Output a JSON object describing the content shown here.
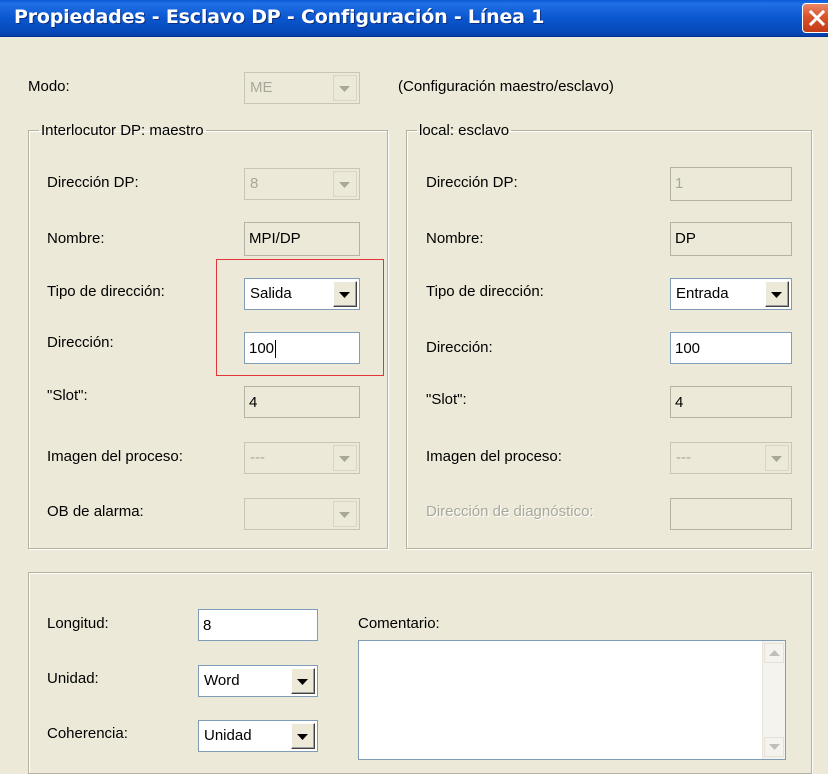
{
  "window": {
    "title": "Propiedades - Esclavo DP - Configuración - Línea 1"
  },
  "mode": {
    "label": "Modo:",
    "value": "ME",
    "description": "(Configuración maestro/esclavo)"
  },
  "master": {
    "legend": "Interlocutor DP: maestro",
    "dp_address_label": "Dirección DP:",
    "dp_address_value": "8",
    "name_label": "Nombre:",
    "name_value": "MPI/DP",
    "address_type_label": "Tipo de dirección:",
    "address_type_value": "Salida",
    "address_label": "Dirección:",
    "address_value": "100",
    "slot_label": "\"Slot\":",
    "slot_value": "4",
    "process_image_label": "Imagen del proceso:",
    "process_image_value": "---",
    "alarm_ob_label": "OB de alarma:",
    "alarm_ob_value": ""
  },
  "slave": {
    "legend": "local: esclavo",
    "dp_address_label": "Dirección DP:",
    "dp_address_value": "1",
    "name_label": "Nombre:",
    "name_value": "DP",
    "address_type_label": "Tipo de dirección:",
    "address_type_value": "Entrada",
    "address_label": "Dirección:",
    "address_value": "100",
    "slot_label": "\"Slot\":",
    "slot_value": "4",
    "process_image_label": "Imagen del proceso:",
    "process_image_value": "---",
    "diag_address_label": "Dirección de diagnóstico:",
    "diag_address_value": ""
  },
  "bottom": {
    "length_label": "Longitud:",
    "length_value": "8",
    "unit_label": "Unidad:",
    "unit_value": "Word",
    "consistency_label": "Coherencia:",
    "consistency_value": "Unidad",
    "comment_label": "Comentario:",
    "comment_value": ""
  },
  "colors": {
    "title_bar": "#0b57d0",
    "highlight_box": "#e0353a",
    "close_button": "#d9532b"
  }
}
